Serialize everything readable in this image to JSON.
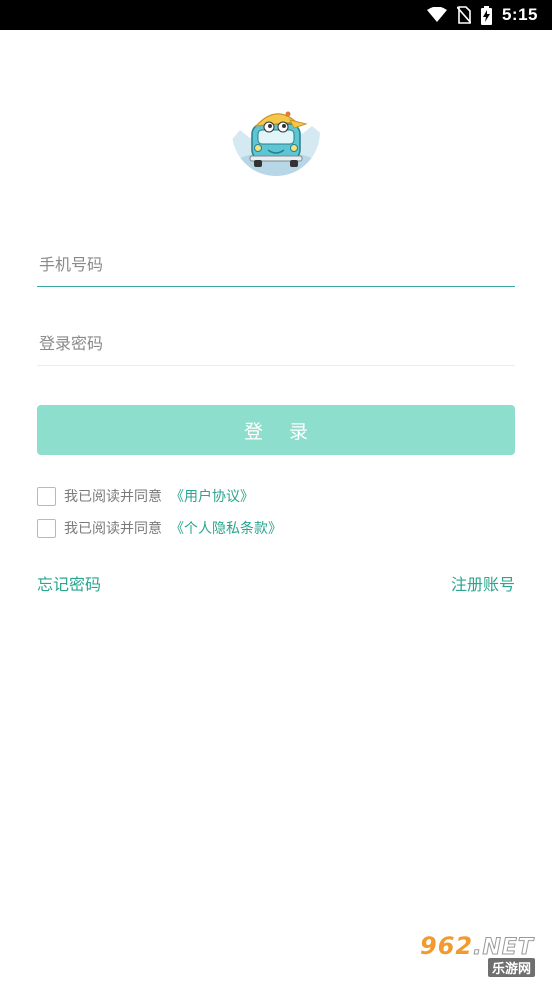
{
  "status_bar": {
    "time": "5:15",
    "icons": [
      "wifi-icon",
      "no-sim-icon",
      "battery-charging-icon"
    ]
  },
  "logo": {
    "icon": "car-mascot-logo"
  },
  "form": {
    "phone_placeholder": "手机号码",
    "password_placeholder": "登录密码",
    "login_label": "登 录"
  },
  "agreements": [
    {
      "text": "我已阅读并同意",
      "link": "《用户协议》",
      "checked": false
    },
    {
      "text": "我已阅读并同意",
      "link": "《个人隐私条款》",
      "checked": false
    }
  ],
  "links": {
    "forgot_password": "忘记密码",
    "register": "注册账号"
  },
  "watermark": {
    "brand": "962",
    "suffix": ".NET",
    "sub": "乐游网"
  },
  "colors": {
    "accent": "#2aa58f",
    "button": "#8ddecd",
    "underline_active": "#3aa6a0"
  }
}
